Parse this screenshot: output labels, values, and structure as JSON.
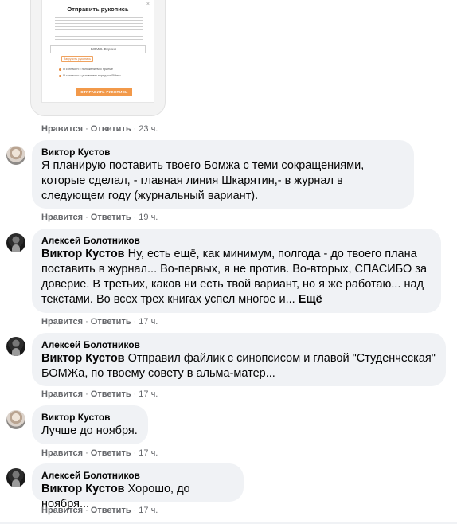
{
  "attachment": {
    "form_title": "Отправить рукопись",
    "close_glyph": "×",
    "input_value": "БОМЖ. Версия",
    "upload_label": "Загрузить рукопись",
    "agree_1": "Я согласен с положением о приеме",
    "agree_2": "Я согласен с условиями передачи Ridero",
    "submit_label": "ОТПРАВИТЬ РУКОПИСЬ"
  },
  "actions": {
    "like": "Нравится",
    "reply": "Ответить",
    "separator": "·"
  },
  "top_time": "23 ч.",
  "comments": [
    {
      "author": "Виктор Кустов",
      "mention": "",
      "text": "Я планирую поставить твоего Бомжа с теми сокращениями, которые сделал, - главная линия Шкарятин,- в журнал в следующем году (журнальный вариант).",
      "more": "",
      "time": "19 ч."
    },
    {
      "author": "Алексей Болотников",
      "mention": "Виктор Кустов",
      "text": " Ну, есть ещё, как минимум, полгода - до твоего плана поставить в журнал... Во-первых, я не против. Во-вторых, СПАСИБО за доверие. В третьих, каков ни есть твой вариант, но я же работаю... над текстами. Во всех трех книгах успел многое и...",
      "more": "Ещё",
      "time": "17 ч."
    },
    {
      "author": "Алексей Болотников",
      "mention": "Виктор Кустов",
      "text": " Отправил файлик с синопсисом и главой \"Студенческая\" БОМЖа, по твоему совету в альма-матер...",
      "more": "",
      "time": "17 ч."
    },
    {
      "author": "Виктор Кустов",
      "mention": "",
      "text": "Лучше до ноября.",
      "more": "",
      "time": "17 ч."
    },
    {
      "author": "Алексей Болотников",
      "mention": "Виктор Кустов",
      "text": " Хорошо, до ноября...",
      "more": "",
      "time": "17 ч."
    }
  ]
}
